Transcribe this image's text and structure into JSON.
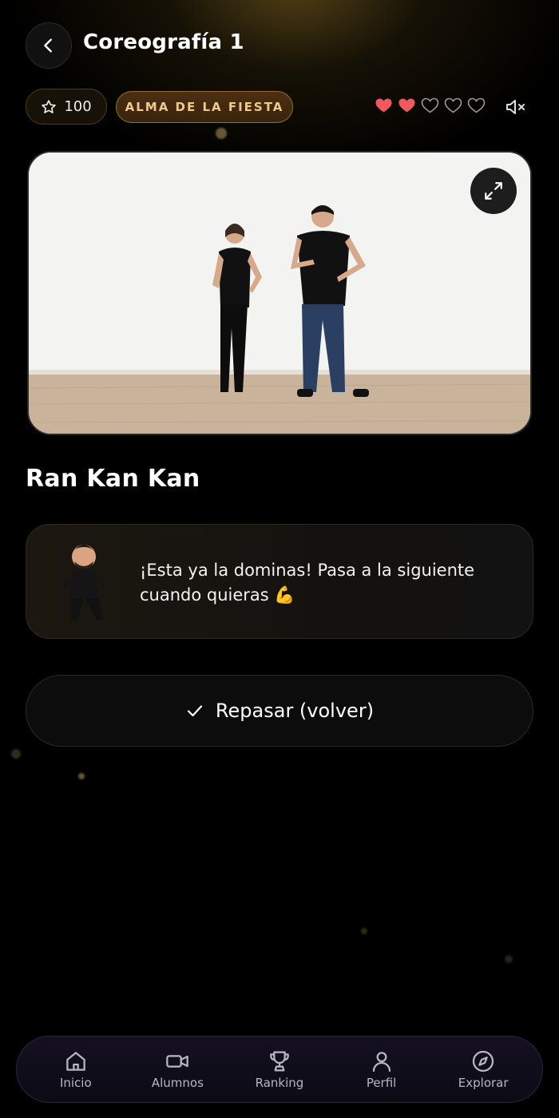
{
  "header": {
    "title": "Coreografía 1"
  },
  "status": {
    "points": "100",
    "badge": "ALMA DE LA FIESTA",
    "hearts_total": 5,
    "hearts_filled": 2,
    "heart_color": "#f05a5f",
    "sound": "muted"
  },
  "video": {
    "expand_icon": "expand-icon"
  },
  "song": {
    "title": "Ran Kan Kan"
  },
  "message": {
    "text": "¡Esta ya la dominas! Pasa a la siguiente cuando quieras 💪"
  },
  "review_button": {
    "label": "Repasar (volver)"
  },
  "nav": {
    "items": [
      {
        "label": "Inicio",
        "icon": "home-icon"
      },
      {
        "label": "Alumnos",
        "icon": "video-camera-icon"
      },
      {
        "label": "Ranking",
        "icon": "trophy-icon"
      },
      {
        "label": "Perfil",
        "icon": "user-icon"
      },
      {
        "label": "Explorar",
        "icon": "compass-icon"
      }
    ]
  },
  "colors": {
    "background": "#000000",
    "accent_gold": "#f0c98c",
    "nav_background": "#141021"
  }
}
